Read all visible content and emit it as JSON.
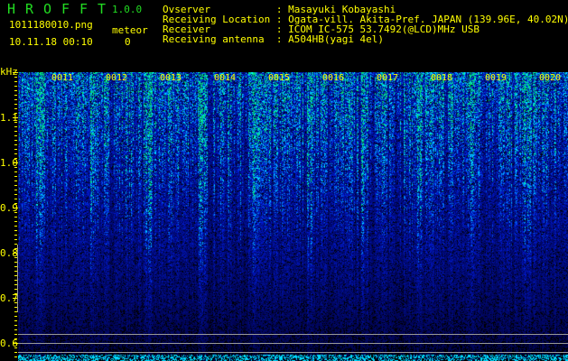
{
  "header": {
    "app_title_letters": [
      "H",
      "R",
      "O",
      "F",
      "F",
      "T"
    ],
    "version": "1.0.0",
    "file_name": "1011180010.png",
    "datetime": "10.11.18 00:10",
    "meteor_label": "meteor",
    "meteor_count": "0"
  },
  "info": [
    {
      "label": "Ovserver           ",
      "value": ": Masayuki Kobayashi"
    },
    {
      "label": "Receiving Location ",
      "value": ": Ogata-vill. Akita-Pref. JAPAN (139.96E, 40.02N)"
    },
    {
      "label": "Receiver           ",
      "value": ": ICOM IC-575 53.7492(@LCD)MHz USB"
    },
    {
      "label": "Receiving antenna  ",
      "value": ": A504HB(yagi 4el)"
    }
  ],
  "spectrogram": {
    "y_unit": "kHz",
    "y_ticks": [
      "1.1",
      "1.0",
      "0.9",
      "0.8",
      "0.7",
      "0.6"
    ],
    "y_range_khz": [
      0.57,
      1.2
    ],
    "time_labels": [
      "0011",
      "0012",
      "0013",
      "0014",
      "0015",
      "0016",
      "0017",
      "0018",
      "0019",
      "0020"
    ],
    "colors": {
      "text": "#ffff00",
      "title": "#22dd22",
      "signal_low": "#0010a0",
      "signal_high": "#00ffff"
    }
  }
}
